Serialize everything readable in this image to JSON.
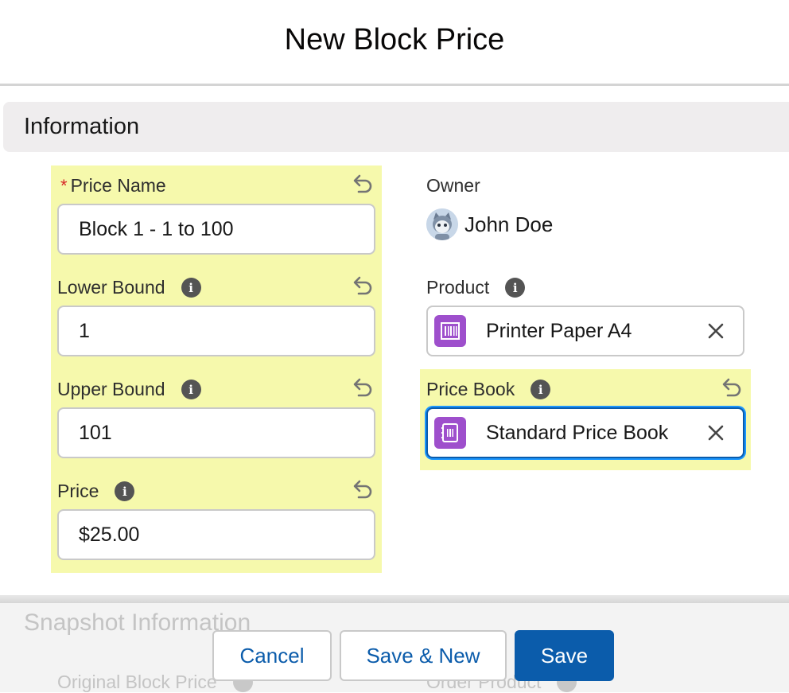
{
  "modal": {
    "title": "New Block Price"
  },
  "section": {
    "title": "Information"
  },
  "fields": {
    "price_name": {
      "label": "Price Name",
      "required_mark": "*",
      "value": "Block 1 - 1 to 100"
    },
    "lower_bound": {
      "label": "Lower Bound",
      "value": "1"
    },
    "upper_bound": {
      "label": "Upper Bound",
      "value": "101"
    },
    "price": {
      "label": "Price",
      "value": "$25.00"
    },
    "owner": {
      "label": "Owner",
      "value": "John Doe"
    },
    "product": {
      "label": "Product",
      "value": "Printer Paper A4"
    },
    "price_book": {
      "label": "Price Book",
      "value": "Standard Price Book"
    }
  },
  "snapshot": {
    "title": "Snapshot Information",
    "left_label": "Original Block Price",
    "right_label": "Order Product"
  },
  "buttons": {
    "cancel": "Cancel",
    "save_new": "Save & New",
    "save": "Save"
  },
  "colors": {
    "highlight": "#f6f9ac",
    "brand": "#0b5cab",
    "lookup_icon": "#9e4fcc",
    "required": "#d62828"
  },
  "icons": {
    "undo": "undo-icon",
    "info": "info-icon",
    "product": "product-icon",
    "price_book": "pricebook-icon",
    "clear": "close-icon",
    "avatar": "user-avatar"
  }
}
